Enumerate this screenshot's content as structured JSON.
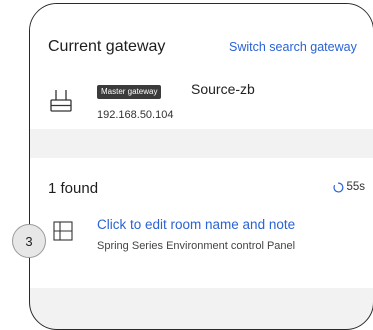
{
  "gateway": {
    "title": "Current gateway",
    "switch_label": "Switch search gateway",
    "badge": "Master gateway",
    "name": "Source-zb",
    "ip": "192.168.50.104",
    "icon": "gateway-icon"
  },
  "found": {
    "count_label": "1 found",
    "timer": "55s",
    "spinner_icon": "loading-spinner-icon",
    "device": {
      "title": "Click to edit room name and note",
      "subtitle": "Spring Series Environment control Panel",
      "icon": "panel-grid-icon"
    }
  },
  "step_marker": "3",
  "colors": {
    "accent": "#2a63d4",
    "badge_bg": "#3b3b3b",
    "page_bg": "#f2f2f3"
  }
}
